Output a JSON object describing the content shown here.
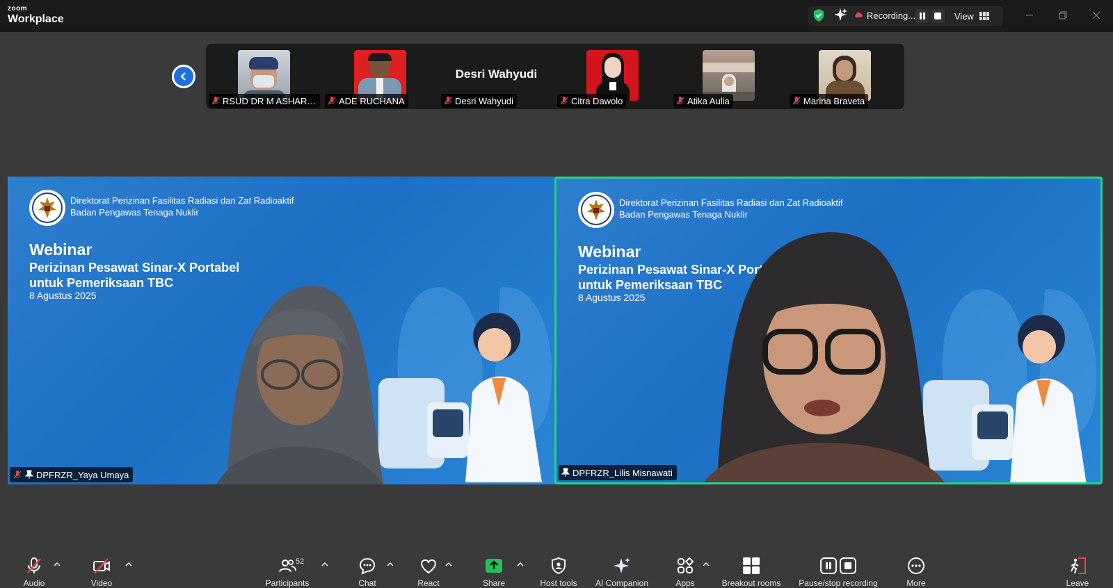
{
  "app": {
    "brand_small": "zoom",
    "brand_large": "Workplace"
  },
  "topbar": {
    "recording_label": "Recording...",
    "view_label": "View"
  },
  "thumbnails": [
    {
      "name": "RSUD DR M ASHARI P...",
      "muted": true
    },
    {
      "name": "ADE RUCHANA",
      "muted": true
    },
    {
      "name": "Desri Wahyudi",
      "display_name": "Desri Wahyudi",
      "muted": true
    },
    {
      "name": "Citra Dawolo",
      "muted": true
    },
    {
      "name": "Atika Aulia",
      "muted": true
    },
    {
      "name": "Marina Braveta",
      "muted": true
    }
  ],
  "slide": {
    "org_line1": "Direktorat Perizinan Fasilitas Radiasi dan Zat Radioaktif",
    "org_line2": "Badan Pengawas Tenaga Nuklir",
    "heading": "Webinar",
    "topic_line1": "Perizinan Pesawat Sinar-X Portabel",
    "topic_line2": "untuk Pemeriksaan TBC",
    "date": "8 Agustus 2025"
  },
  "tiles": [
    {
      "name": "DPFRZR_Yaya Umaya",
      "muted": true,
      "pinned": true,
      "active_speaker": false
    },
    {
      "name": "DPFRZR_Lilis Misnawati",
      "muted": false,
      "pinned": true,
      "active_speaker": true
    }
  ],
  "toolbar": {
    "audio": "Audio",
    "video": "Video",
    "participants": "Participants",
    "participants_count": "52",
    "chat": "Chat",
    "react": "React",
    "share": "Share",
    "host_tools": "Host tools",
    "ai_companion": "AI Companion",
    "apps": "Apps",
    "breakout_rooms": "Breakout rooms",
    "pause_stop_recording": "Pause/stop recording",
    "more": "More",
    "leave": "Leave"
  },
  "colors": {
    "accent_blue": "#1e6fe0",
    "active_speaker": "#23d18b",
    "share_green": "#21c15c",
    "mute_red": "#e0464a",
    "leave_red": "#e0464a"
  }
}
